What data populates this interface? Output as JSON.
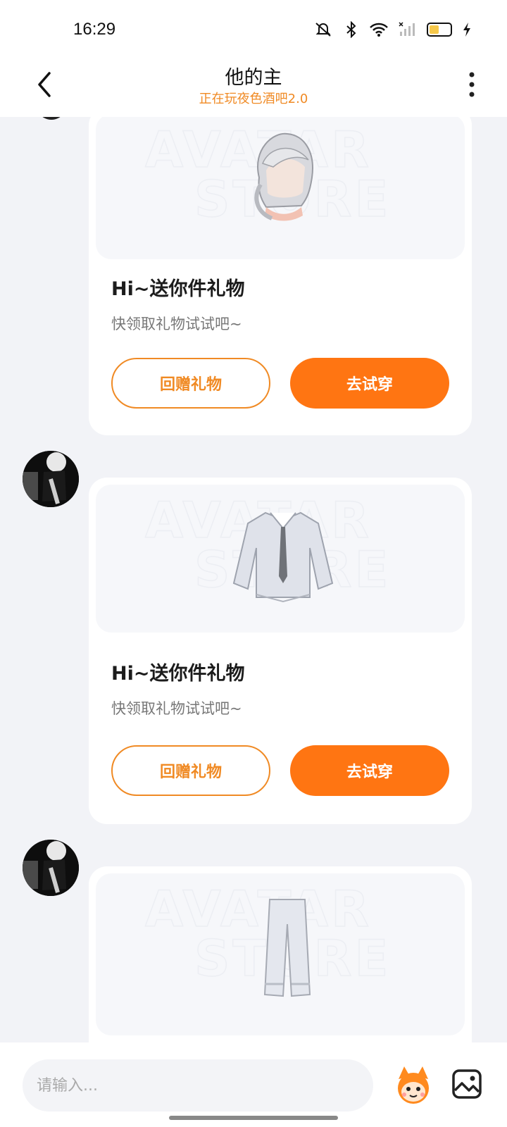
{
  "status_bar": {
    "time": "16:29",
    "icons": [
      "mute-icon",
      "bluetooth-icon",
      "wifi-icon",
      "signal-icon",
      "battery-icon",
      "charging-icon"
    ],
    "battery_level": 0.45
  },
  "header": {
    "title": "他的主",
    "subtitle": "正在玩夜色酒吧2.0",
    "back_icon": "chevron-left-icon",
    "more_icon": "more-vertical-icon"
  },
  "colors": {
    "accent": "#ff7512",
    "accent_outline": "#f08a24",
    "background": "#f2f3f7"
  },
  "messages": [
    {
      "watermark": "AVATAR STORE",
      "item": "hair",
      "title": "Hi~送你件礼物",
      "subtitle": "快领取礼物试试吧~",
      "return_gift_label": "回赠礼物",
      "try_on_label": "去试穿"
    },
    {
      "watermark": "AVATAR STORE",
      "item": "shirt",
      "title": "Hi~送你件礼物",
      "subtitle": "快领取礼物试试吧~",
      "return_gift_label": "回赠礼物",
      "try_on_label": "去试穿"
    },
    {
      "watermark": "AVATAR STORE",
      "item": "pants"
    }
  ],
  "input_bar": {
    "placeholder": "请输入...",
    "mascot_icon": "mascot-icon",
    "image_icon": "image-icon"
  }
}
